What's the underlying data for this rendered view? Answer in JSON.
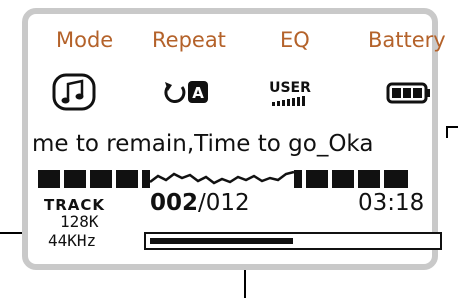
{
  "header": {
    "mode_label": "Mode",
    "repeat_label": "Repeat",
    "eq_label": "EQ",
    "battery_label": "Battery"
  },
  "status_icons": {
    "mode_icon": "music-note-icon",
    "repeat_icon": "repeat-all-icon",
    "repeat_badge": "A",
    "eq_icon": "eq-user-icon",
    "eq_text": "USER",
    "battery_icon": "battery-full-icon",
    "battery_level": 1.0
  },
  "now_playing": {
    "scrolling_title": "me to remain,Time to go_Oka"
  },
  "track": {
    "label": "TRACK",
    "current": "002",
    "total": "/012",
    "time": "03:18",
    "bitrate": "128K",
    "sample_rate": "44KHz"
  },
  "progress": {
    "fraction": 0.5
  },
  "colors": {
    "header_text": "#b4622a",
    "lcd_border": "#c9c9c9",
    "lcd_ink": "#111111"
  }
}
